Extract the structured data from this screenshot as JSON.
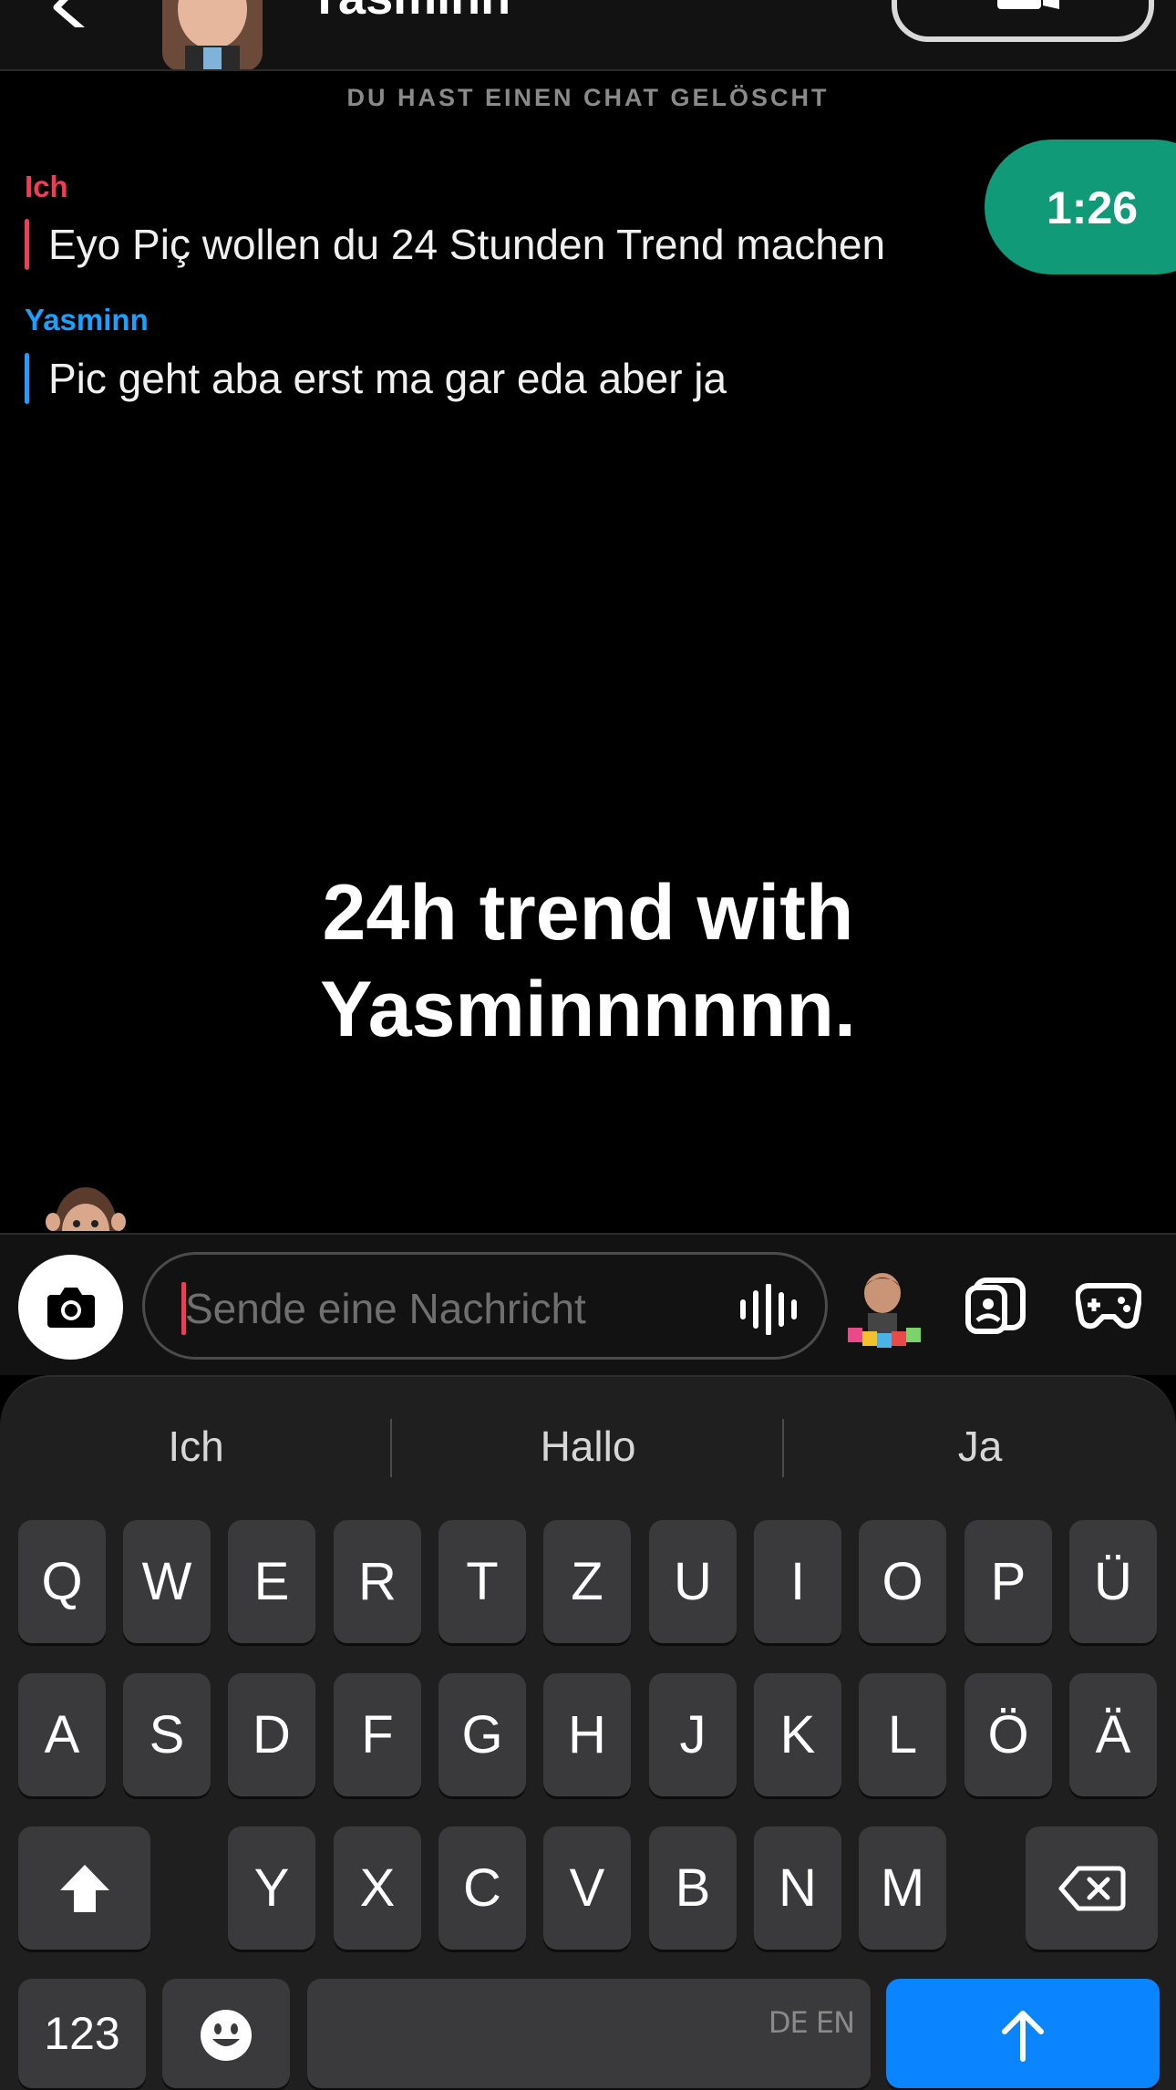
{
  "header": {
    "contact_name": "Yasminn",
    "deleted_notice": "DU HAST EINEN CHAT GELÖSCHT"
  },
  "messages": [
    {
      "sender": "Ich",
      "text": "Eyo Piç wollen du 24 Stunden Trend machen",
      "color": "#f23c57"
    },
    {
      "sender": "Yasminn",
      "text": "Pic geht aba erst ma gar eda aber ja",
      "color": "#1aa0ff"
    }
  ],
  "timer": "1:26",
  "overlay_caption": [
    "24h trend with",
    "Yasminnnnnn."
  ],
  "input": {
    "placeholder": "Sende eine Nachricht"
  },
  "keyboard": {
    "suggestions": [
      "Ich",
      "Hallo",
      "Ja"
    ],
    "row1": [
      "Q",
      "W",
      "E",
      "R",
      "T",
      "Z",
      "U",
      "I",
      "O",
      "P",
      "Ü"
    ],
    "row2": [
      "A",
      "S",
      "D",
      "F",
      "G",
      "H",
      "J",
      "K",
      "L",
      "Ö",
      "Ä"
    ],
    "row3": [
      "Y",
      "X",
      "C",
      "V",
      "B",
      "N",
      "M"
    ],
    "numbers_label": "123",
    "language_label": "DE EN",
    "return_color": "#0a84ff"
  },
  "icons": [
    "back-icon",
    "video-camera-icon",
    "camera-icon",
    "voice-icon",
    "bitmoji-icon",
    "sticker-icon",
    "games-icon",
    "shift-icon",
    "backspace-icon",
    "emoji-icon",
    "send-arrow-icon"
  ]
}
